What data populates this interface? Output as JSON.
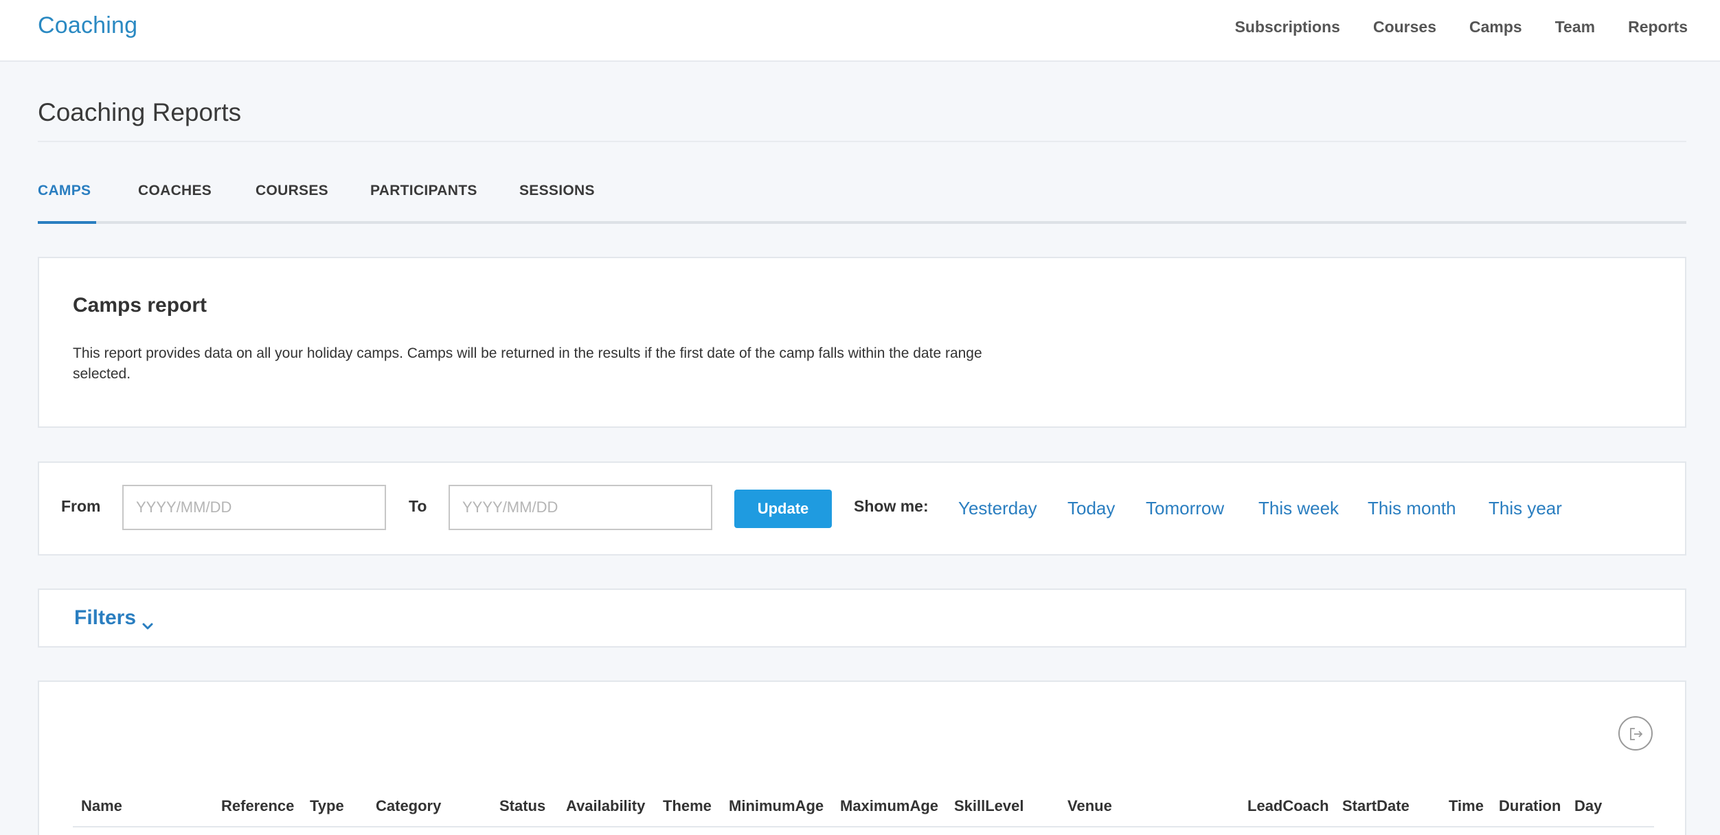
{
  "brand": "Coaching",
  "nav": [
    "Subscriptions",
    "Courses",
    "Camps",
    "Team",
    "Reports"
  ],
  "page_title": "Coaching Reports",
  "tabs": [
    "CAMPS",
    "COACHES",
    "COURSES",
    "PARTICIPANTS",
    "SESSIONS"
  ],
  "active_tab": "CAMPS",
  "report": {
    "title": "Camps report",
    "description": "This report provides data on all your holiday camps. Camps will be returned in the results if the first date of the camp falls within the date range selected."
  },
  "date_range": {
    "from_label": "From",
    "from_placeholder": "YYYY/MM/DD",
    "from_value": "",
    "to_label": "To",
    "to_placeholder": "YYYY/MM/DD",
    "to_value": "",
    "update_label": "Update",
    "show_me_label": "Show me:",
    "quick_links": [
      "Yesterday",
      "Today",
      "Tomorrow",
      "This week",
      "This month",
      "This year"
    ]
  },
  "filters": {
    "label": "Filters",
    "icon": "chevron-down-icon"
  },
  "table": {
    "export_icon": "export-icon",
    "columns": [
      "Name",
      "Reference",
      "Type",
      "Category",
      "Status",
      "Availability",
      "Theme",
      "MinimumAge",
      "MaximumAge",
      "SkillLevel",
      "Venue",
      "LeadCoach",
      "StartDate",
      "Time",
      "Duration",
      "Day"
    ]
  },
  "colors": {
    "accent": "#2a7ec0",
    "button": "#1f9be0",
    "background": "#f5f7fa"
  }
}
